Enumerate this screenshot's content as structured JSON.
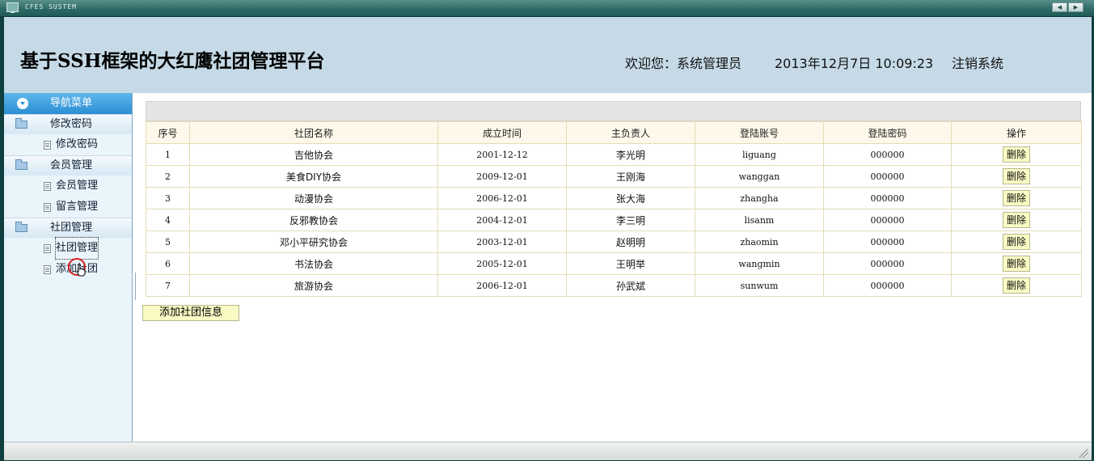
{
  "window": {
    "title": "CFES SUSTEM",
    "nav_prev": "◀",
    "nav_next": "▶"
  },
  "header": {
    "title": "基于SSH框架的大红鹰社团管理平台",
    "welcome": "欢迎您：系统管理员",
    "datetime": "2013年12月7日  10:09:23",
    "logout": "注销系统"
  },
  "sidebar": {
    "header": "导航菜单",
    "groups": [
      {
        "label": "修改密码",
        "items": [
          {
            "label": "修改密码"
          }
        ]
      },
      {
        "label": "会员管理",
        "items": [
          {
            "label": "会员管理"
          },
          {
            "label": "留言管理"
          }
        ]
      },
      {
        "label": "社团管理",
        "items": [
          {
            "label": "社团管理"
          },
          {
            "label": "添加社团"
          }
        ]
      }
    ]
  },
  "table": {
    "columns": [
      "序号",
      "社团名称",
      "成立时间",
      "主负责人",
      "登陆账号",
      "登陆密码",
      "操作"
    ],
    "delete_label": "删除",
    "rows": [
      {
        "id": "1",
        "name": "吉他协会",
        "date": "2001-12-12",
        "leader": "李光明",
        "account": "liguang",
        "password": "000000"
      },
      {
        "id": "2",
        "name": "美食DIY协会",
        "date": "2009-12-01",
        "leader": "王刚海",
        "account": "wanggan",
        "password": "000000"
      },
      {
        "id": "3",
        "name": "动漫协会",
        "date": "2006-12-01",
        "leader": "张大海",
        "account": "zhangha",
        "password": "000000"
      },
      {
        "id": "4",
        "name": "反邪教协会",
        "date": "2004-12-01",
        "leader": "李三明",
        "account": "lisanm",
        "password": "000000"
      },
      {
        "id": "5",
        "name": "邓小平研究协会",
        "date": "2003-12-01",
        "leader": "赵明明",
        "account": "zhaomin",
        "password": "000000"
      },
      {
        "id": "6",
        "name": "书法协会",
        "date": "2005-12-01",
        "leader": "王明举",
        "account": "wangmin",
        "password": "000000"
      },
      {
        "id": "7",
        "name": "旅游协会",
        "date": "2006-12-01",
        "leader": "孙武斌",
        "account": "sunwum",
        "password": "000000"
      }
    ]
  },
  "add_button": "添加社团信息",
  "colors": {
    "header_bg": "#c5dae6",
    "nav_header": "#2c8ed2",
    "button_bg": "#fafac5",
    "table_border": "#e3dcb3"
  }
}
